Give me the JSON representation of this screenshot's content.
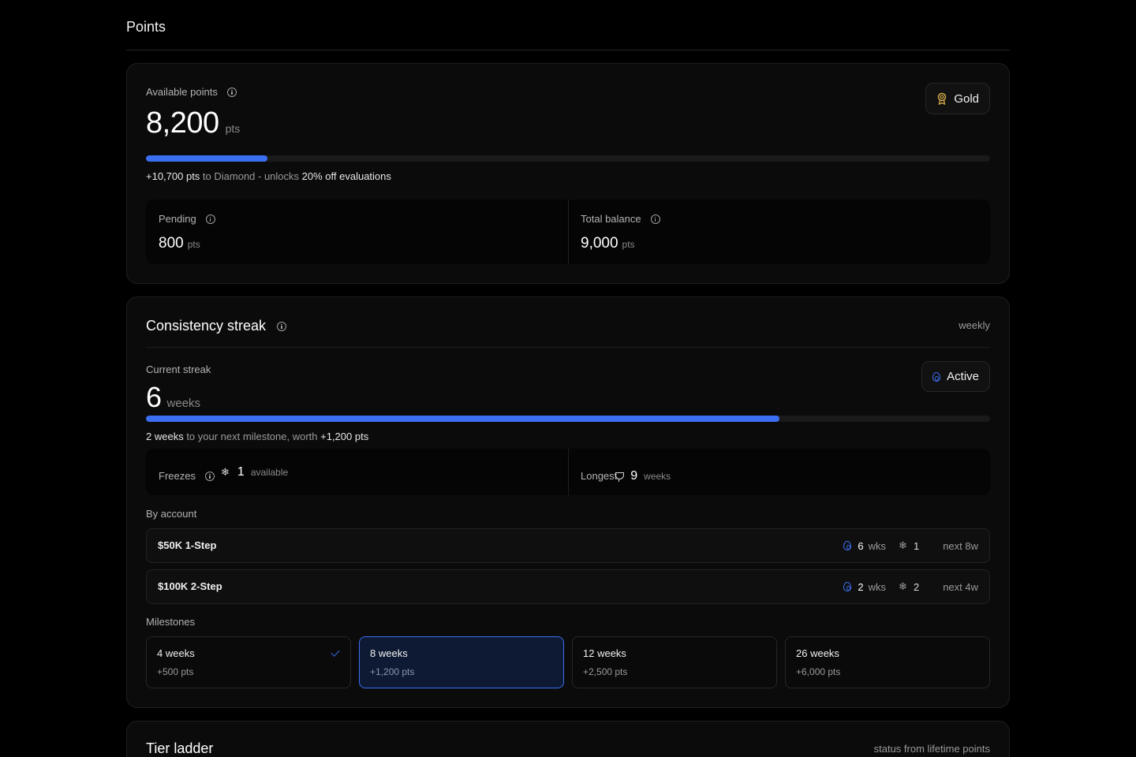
{
  "page": {
    "title": "Points"
  },
  "points": {
    "available_label": "Available points",
    "available_value": "8,200",
    "unit": "pts",
    "progress": 0.144,
    "progress_color": "#3b6ef0",
    "tier_badge": {
      "label": "Gold",
      "icon": "medal-icon"
    },
    "next_tier": {
      "amount": "+10,700 pts",
      "to_text": " to Diamond - unlocks ",
      "perk": "20% off evaluations"
    },
    "pending": {
      "label": "Pending",
      "value": "800",
      "unit": "pts"
    },
    "total_balance": {
      "label": "Total balance",
      "value": "9,000",
      "unit": "pts"
    }
  },
  "streak": {
    "title": "Consistency streak",
    "cadence": "weekly",
    "current_label": "Current streak",
    "current_value": "6",
    "current_unit": "weeks",
    "status_badge": {
      "label": "Active",
      "icon": "flame-icon"
    },
    "progress": 0.75,
    "next_milestone": {
      "weeks": "2 weeks",
      "middle": " to your next milestone, worth ",
      "reward": "+1,200 pts"
    },
    "freezes": {
      "label": "Freezes",
      "value": "1",
      "unit": "available",
      "icon": "snowflake-icon"
    },
    "longest": {
      "label": "Longest",
      "value": "9",
      "unit": "weeks",
      "icon": "trophy-icon"
    },
    "by_account_label": "By account",
    "accounts": [
      {
        "name": "$50K 1-Step",
        "weeks": "6",
        "weeks_unit": "wks",
        "freezes": "1",
        "next": "next 8w"
      },
      {
        "name": "$100K 2-Step",
        "weeks": "2",
        "weeks_unit": "wks",
        "freezes": "2",
        "next": "next 4w"
      }
    ],
    "milestones_label": "Milestones",
    "milestones": [
      {
        "title": "4 weeks",
        "reward": "+500 pts",
        "state": "completed"
      },
      {
        "title": "8 weeks",
        "reward": "+1,200 pts",
        "state": "current"
      },
      {
        "title": "12 weeks",
        "reward": "+2,500 pts",
        "state": "upcoming"
      },
      {
        "title": "26 weeks",
        "reward": "+6,000 pts",
        "state": "upcoming"
      }
    ]
  },
  "tier_ladder": {
    "title": "Tier ladder",
    "subtitle": "status from lifetime points"
  },
  "colors": {
    "accent": "#3b6ef0",
    "gold": "#d4a94a"
  }
}
